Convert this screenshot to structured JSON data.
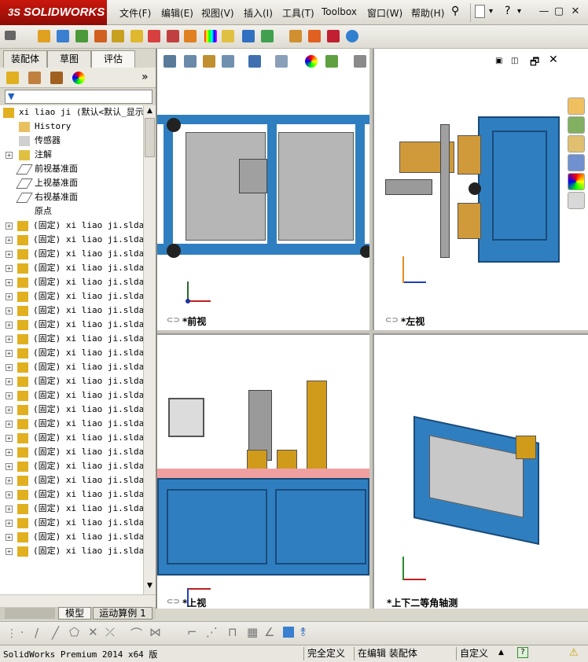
{
  "app": {
    "brand": "SOLIDWORKS",
    "brand_ds": "3S"
  },
  "menu": [
    "文件(F)",
    "编辑(E)",
    "视图(V)",
    "插入(I)",
    "工具(T)",
    "Toolbox",
    "窗口(W)",
    "帮助(H)"
  ],
  "window_buttons": [
    "—",
    "▢",
    "✕"
  ],
  "left_tabs": [
    "装配体",
    "草图",
    "评估"
  ],
  "tree": {
    "root": "xi liao ji  (默认<默认_显示",
    "items": [
      {
        "label": "History",
        "icon": "history-icon"
      },
      {
        "label": "传感器",
        "icon": "sensor-icon"
      },
      {
        "label": "注解",
        "icon": "annotation-icon"
      },
      {
        "label": "前视基准面",
        "icon": "plane-icon"
      },
      {
        "label": "上视基准面",
        "icon": "plane-icon"
      },
      {
        "label": "右视基准面",
        "icon": "plane-icon"
      },
      {
        "label": "原点",
        "icon": "origin-icon"
      }
    ],
    "component_label": "(固定) xi liao ji.sldas",
    "component_count": 24
  },
  "bottom_tabs": [
    "模型",
    "运动算例 1"
  ],
  "viewports": {
    "front": "*前视",
    "left": "*左视",
    "top": "*上视",
    "iso": "*上下二等角轴测"
  },
  "status": {
    "product": "SolidWorks Premium 2014 x64 版",
    "fully_defined": "完全定义",
    "editing": "在编辑 装配体",
    "custom": "自定义"
  },
  "colors": {
    "frame_blue": "#2f7fc0",
    "accent_orange": "#d19428",
    "brand_red": "#c9170d"
  }
}
